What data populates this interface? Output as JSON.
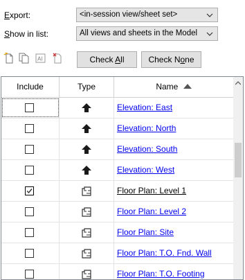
{
  "export": {
    "label_prefix": "",
    "label_underlined": "E",
    "label_rest": "xport:",
    "value": "<in-session view/sheet set>"
  },
  "show_in_list": {
    "label_underlined": "S",
    "label_rest": "how in list:",
    "value": "All views and sheets in the Model"
  },
  "toolbar": {
    "icons": [
      "new-set-icon",
      "duplicate-set-icon",
      "rename-set-icon",
      "delete-set-icon"
    ],
    "check_all_pre": "Check ",
    "check_all_u": "A",
    "check_all_post": "ll",
    "check_none_pre": "Check N",
    "check_none_u": "o",
    "check_none_post": "ne"
  },
  "table": {
    "columns": {
      "include": "Include",
      "type": "Type",
      "name": "Name"
    },
    "sort": "ascending",
    "rows": [
      {
        "include": false,
        "type": "elevation",
        "name": "Elevation: East",
        "focused": true
      },
      {
        "include": false,
        "type": "elevation",
        "name": "Elevation: North"
      },
      {
        "include": false,
        "type": "elevation",
        "name": "Elevation: South"
      },
      {
        "include": false,
        "type": "elevation",
        "name": "Elevation: West"
      },
      {
        "include": true,
        "type": "floor-plan",
        "name": "Floor Plan: Level 1",
        "current": true
      },
      {
        "include": false,
        "type": "floor-plan",
        "name": "Floor Plan: Level 2"
      },
      {
        "include": false,
        "type": "floor-plan",
        "name": "Floor Plan: Site"
      },
      {
        "include": false,
        "type": "floor-plan",
        "name": "Floor Plan: T.O. Fnd. Wall"
      },
      {
        "include": false,
        "type": "floor-plan",
        "name": "Floor Plan: T.O. Footing"
      }
    ]
  },
  "colors": {
    "link": "#0000ee",
    "button_bg": "#e1e1e1",
    "combo_bg": "#e5e5e5"
  }
}
